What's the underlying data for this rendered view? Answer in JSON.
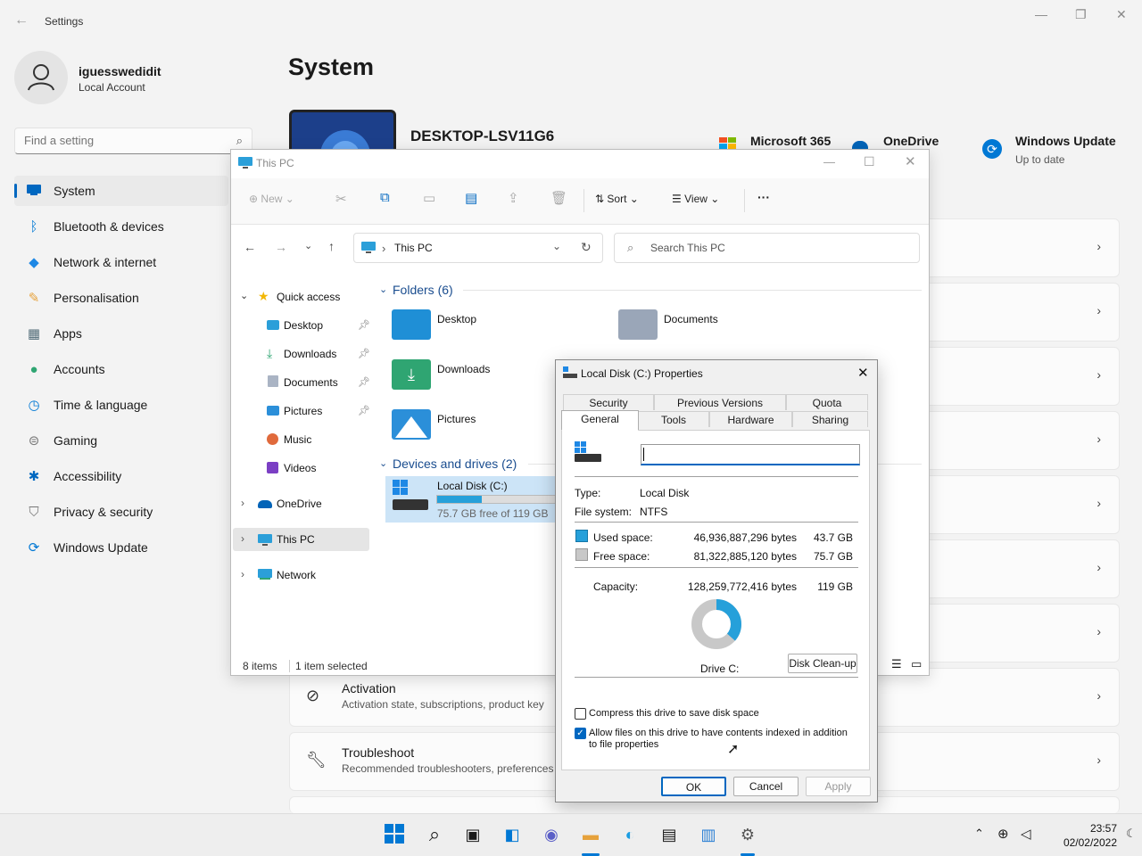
{
  "settings": {
    "title": "Settings",
    "user_name": "iguesswedidit",
    "user_type": "Local Account",
    "search_placeholder": "Find a setting",
    "page_title": "System",
    "nav": [
      {
        "label": "System",
        "icon": "monitor-icon",
        "color": "#0067c0"
      },
      {
        "label": "Bluetooth & devices",
        "icon": "bluetooth-icon",
        "color": "#0078d4"
      },
      {
        "label": "Network & internet",
        "icon": "wifi-icon",
        "color": "#1e88e5"
      },
      {
        "label": "Personalisation",
        "icon": "brush-icon",
        "color": "#e6a23c"
      },
      {
        "label": "Apps",
        "icon": "apps-icon",
        "color": "#546e7a"
      },
      {
        "label": "Accounts",
        "icon": "person-icon",
        "color": "#2fa572"
      },
      {
        "label": "Time & language",
        "icon": "clock-globe-icon",
        "color": "#0078d4"
      },
      {
        "label": "Gaming",
        "icon": "gamepad-icon",
        "color": "#777777"
      },
      {
        "label": "Accessibility",
        "icon": "accessibility-icon",
        "color": "#0067c0"
      },
      {
        "label": "Privacy & security",
        "icon": "shield-icon",
        "color": "#777777"
      },
      {
        "label": "Windows Update",
        "icon": "sync-icon",
        "color": "#0078d4"
      }
    ],
    "device_name": "DESKTOP-LSV11G6",
    "tiles": {
      "m365": "Microsoft 365",
      "onedrive": "OneDrive",
      "windows_update": "Windows Update",
      "windows_update_status": "Up to date"
    },
    "cards": [
      {
        "title": "Activation",
        "subtitle": "Activation state, subscriptions, product key",
        "icon": "check-circle-icon"
      },
      {
        "title": "Troubleshoot",
        "subtitle": "Recommended troubleshooters, preferences",
        "icon": "wrench-icon"
      }
    ]
  },
  "explorer": {
    "title": "This PC",
    "toolbar": {
      "new": "New",
      "sort": "Sort",
      "view": "View",
      "more": "···"
    },
    "address": "This PC",
    "search_placeholder": "Search This PC",
    "tree": {
      "quick_access": "Quick access",
      "desktop": "Desktop",
      "downloads": "Downloads",
      "documents": "Documents",
      "pictures": "Pictures",
      "music": "Music",
      "videos": "Videos",
      "onedrive": "OneDrive",
      "this_pc": "This PC",
      "network": "Network"
    },
    "folders_header": "Folders (6)",
    "folders": [
      "Desktop",
      "Documents",
      "Downloads",
      "Pictures"
    ],
    "drives_header": "Devices and drives (2)",
    "drive": {
      "name": "Local Disk (C:)",
      "free": "75.7 GB free of 119 GB",
      "used_fraction": 0.365
    },
    "status_items": "8 items",
    "status_selected": "1 item selected"
  },
  "props": {
    "title": "Local Disk (C:) Properties",
    "tabs_top": [
      "Security",
      "Previous Versions",
      "Quota"
    ],
    "tabs_bottom": [
      "General",
      "Tools",
      "Hardware",
      "Sharing"
    ],
    "type_label": "Type:",
    "type_value": "Local Disk",
    "fs_label": "File system:",
    "fs_value": "NTFS",
    "used_label": "Used space:",
    "used_bytes": "46,936,887,296 bytes",
    "used_gb": "43.7 GB",
    "free_label": "Free space:",
    "free_bytes": "81,322,885,120 bytes",
    "free_gb": "75.7 GB",
    "cap_label": "Capacity:",
    "cap_bytes": "128,259,772,416 bytes",
    "cap_gb": "119 GB",
    "drive_label": "Drive C:",
    "cleanup": "Disk Clean-up",
    "compress": "Compress this drive to save disk space",
    "index": "Allow files on this drive to have contents indexed in addition to file properties",
    "ok": "OK",
    "cancel": "Cancel",
    "apply": "Apply",
    "used_color": "#26a0da",
    "free_color": "#c8c8c8"
  },
  "taskbar": {
    "time": "23:57",
    "date": "02/02/2022"
  }
}
